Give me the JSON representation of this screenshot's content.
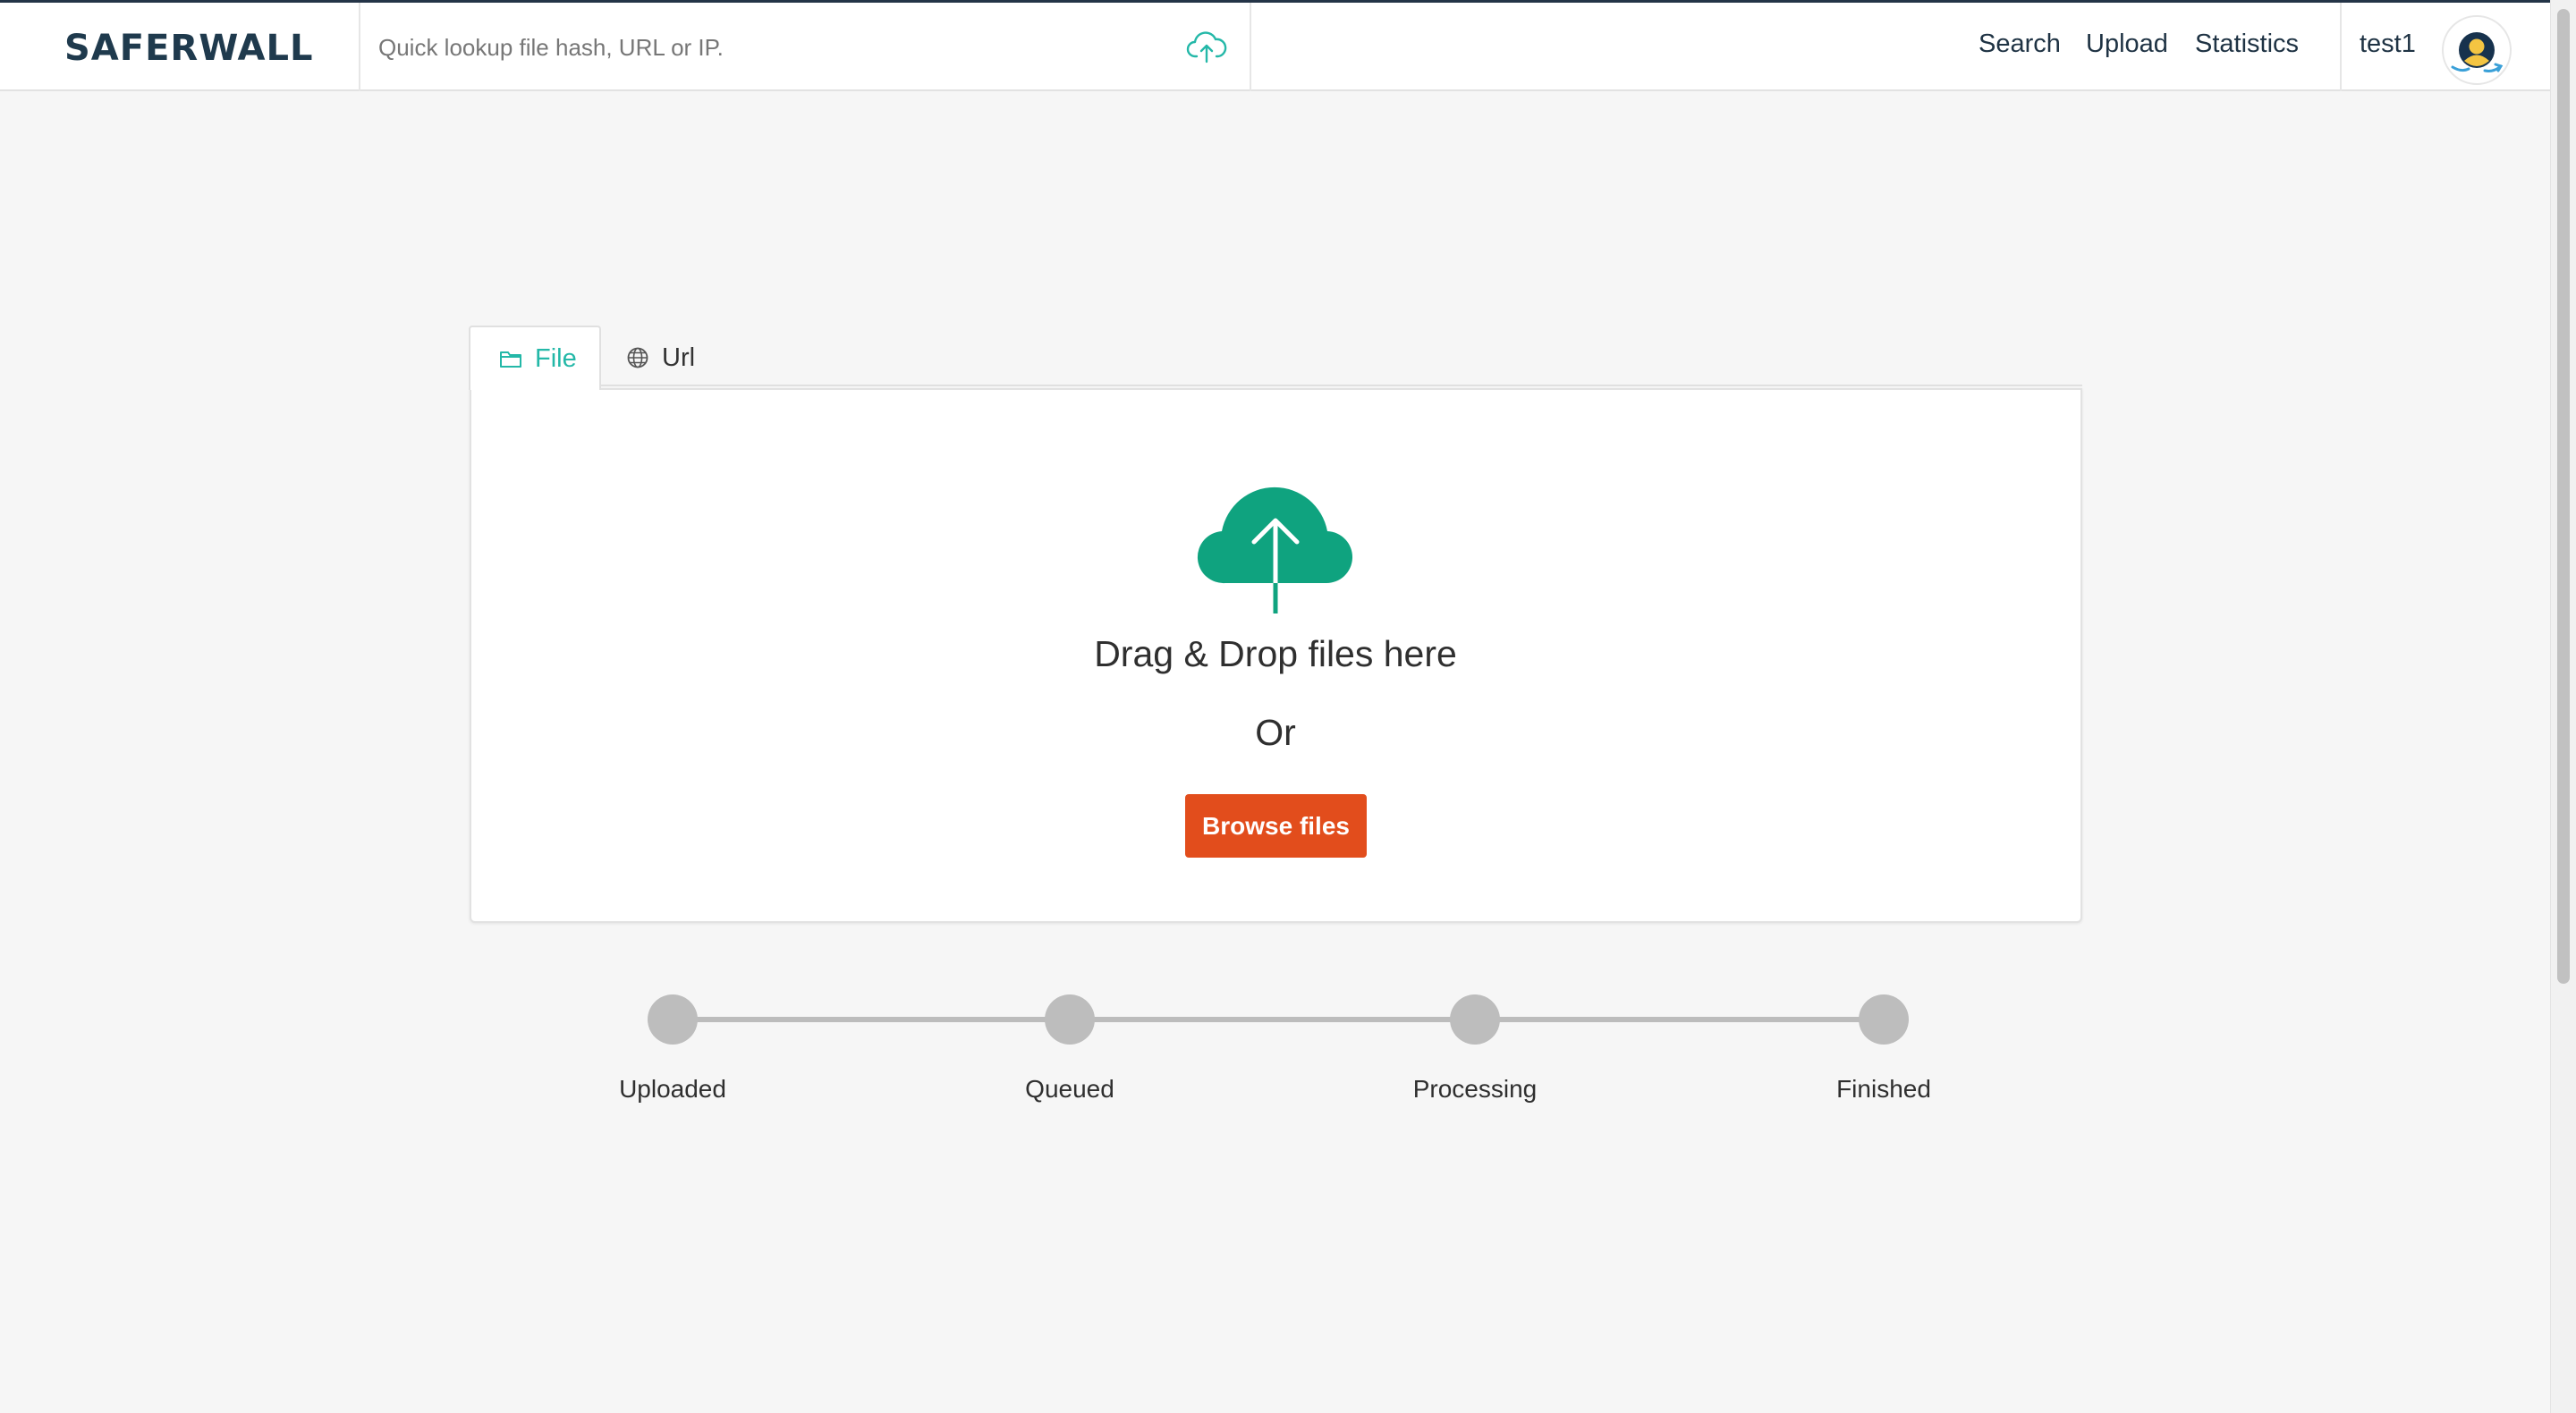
{
  "header": {
    "logo": "SAFERWALL",
    "search": {
      "placeholder": "Quick lookup file hash, URL or IP.",
      "value": ""
    },
    "search_upload_icon": "cloud-upload-icon",
    "nav": [
      "Search",
      "Upload",
      "Statistics"
    ],
    "username": "test1",
    "avatar_icon": "user-avatar-icon"
  },
  "tabs": [
    {
      "label": "File",
      "icon": "folder-icon",
      "active": true
    },
    {
      "label": "Url",
      "icon": "globe-icon",
      "active": false
    }
  ],
  "upload": {
    "icon": "cloud-upload-icon",
    "drop_text": "Drag & Drop files here",
    "or_text": "Or",
    "browse_label": "Browse files"
  },
  "progress": {
    "steps": [
      "Uploaded",
      "Queued",
      "Processing",
      "Finished"
    ],
    "completed": 0
  },
  "colors": {
    "accent": "#24b8a8",
    "upload_icon": "#0fa37f",
    "browse_button": "#e24d1c",
    "logo": "#1f3a4d",
    "step_inactive": "#bdbdbd"
  }
}
